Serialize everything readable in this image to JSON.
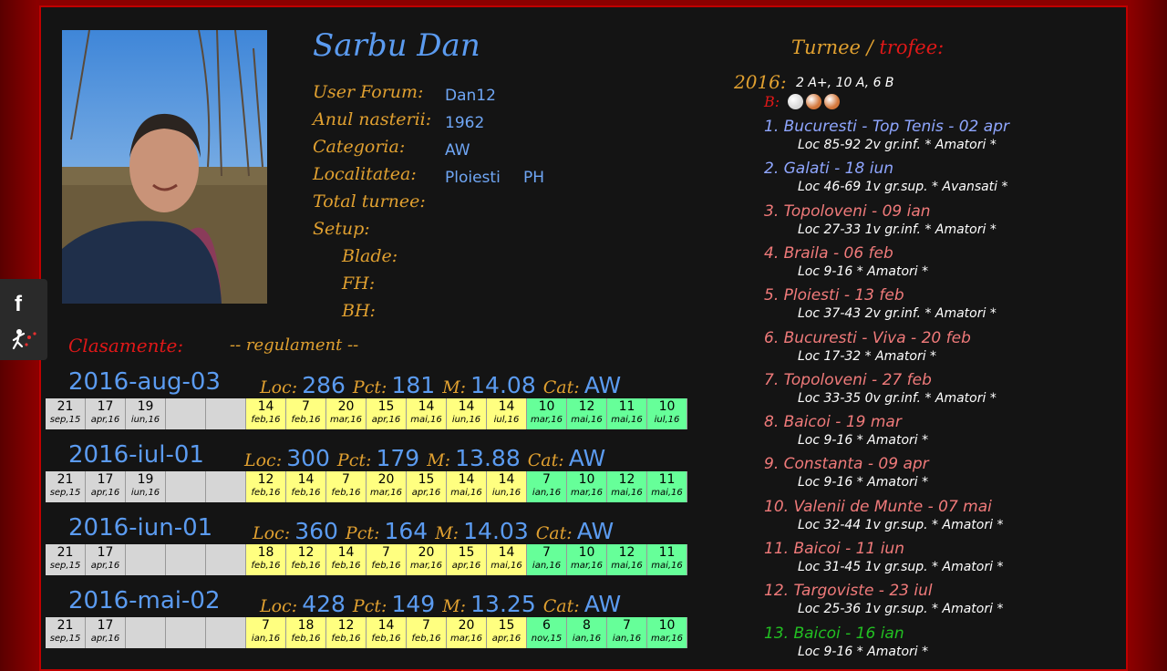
{
  "profile": {
    "name": "Sarbu Dan",
    "labels": [
      "User Forum:",
      "Anul nasterii:",
      "Categoria:",
      "Localitatea:",
      "Total turnee:",
      "Setup:"
    ],
    "setup_labels": [
      "Blade:",
      "FH:",
      "BH:"
    ],
    "user_forum": "Dan12",
    "anul_nasterii": "1962",
    "categoria": "AW",
    "localitatea": "Ploiesti",
    "judet": "PH"
  },
  "clasamente": {
    "title": "Clasamente:",
    "regulament": "-- regulament --",
    "stat_labels": {
      "loc": "Loc:",
      "pct": "Pct:",
      "m": "M:",
      "cat": "Cat:"
    },
    "blocks": [
      {
        "date": "2016-aug-03",
        "loc": "286",
        "pct": "181",
        "m": "14.08",
        "cat": "AW",
        "cells": [
          [
            "21",
            "sep,15",
            "g"
          ],
          [
            "17",
            "apr,16",
            "g"
          ],
          [
            "19",
            "iun,16",
            "g"
          ],
          [
            "",
            "",
            "g"
          ],
          [
            "",
            "",
            "g"
          ],
          [
            "14",
            "feb,16",
            "y"
          ],
          [
            "7",
            "feb,16",
            "y"
          ],
          [
            "20",
            "mar,16",
            "y"
          ],
          [
            "15",
            "apr,16",
            "y"
          ],
          [
            "14",
            "mai,16",
            "y"
          ],
          [
            "14",
            "iun,16",
            "y"
          ],
          [
            "14",
            "iul,16",
            "y"
          ],
          [
            "10",
            "mar,16",
            "gr"
          ],
          [
            "12",
            "mai,16",
            "gr"
          ],
          [
            "11",
            "mai,16",
            "gr"
          ],
          [
            "10",
            "iul,16",
            "gr"
          ]
        ]
      },
      {
        "date": "2016-iul-01",
        "loc": "300",
        "pct": "179",
        "m": "13.88",
        "cat": "AW",
        "cells": [
          [
            "21",
            "sep,15",
            "g"
          ],
          [
            "17",
            "apr,16",
            "g"
          ],
          [
            "19",
            "iun,16",
            "g"
          ],
          [
            "",
            "",
            "g"
          ],
          [
            "",
            "",
            "g"
          ],
          [
            "12",
            "feb,16",
            "y"
          ],
          [
            "14",
            "feb,16",
            "y"
          ],
          [
            "7",
            "feb,16",
            "y"
          ],
          [
            "20",
            "mar,16",
            "y"
          ],
          [
            "15",
            "apr,16",
            "y"
          ],
          [
            "14",
            "mai,16",
            "y"
          ],
          [
            "14",
            "iun,16",
            "y"
          ],
          [
            "7",
            "ian,16",
            "gr"
          ],
          [
            "10",
            "mar,16",
            "gr"
          ],
          [
            "12",
            "mai,16",
            "gr"
          ],
          [
            "11",
            "mai,16",
            "gr"
          ]
        ]
      },
      {
        "date": "2016-iun-01",
        "loc": "360",
        "pct": "164",
        "m": "14.03",
        "cat": "AW",
        "cells": [
          [
            "21",
            "sep,15",
            "g"
          ],
          [
            "17",
            "apr,16",
            "g"
          ],
          [
            "",
            "",
            "g"
          ],
          [
            "",
            "",
            "g"
          ],
          [
            "",
            "",
            "g"
          ],
          [
            "18",
            "feb,16",
            "y"
          ],
          [
            "12",
            "feb,16",
            "y"
          ],
          [
            "14",
            "feb,16",
            "y"
          ],
          [
            "7",
            "feb,16",
            "y"
          ],
          [
            "20",
            "mar,16",
            "y"
          ],
          [
            "15",
            "apr,16",
            "y"
          ],
          [
            "14",
            "mai,16",
            "y"
          ],
          [
            "7",
            "ian,16",
            "gr"
          ],
          [
            "10",
            "mar,16",
            "gr"
          ],
          [
            "12",
            "mai,16",
            "gr"
          ],
          [
            "11",
            "mai,16",
            "gr"
          ]
        ]
      },
      {
        "date": "2016-mai-02",
        "loc": "428",
        "pct": "149",
        "m": "13.25",
        "cat": "AW",
        "cells": [
          [
            "21",
            "sep,15",
            "g"
          ],
          [
            "17",
            "apr,16",
            "g"
          ],
          [
            "",
            "",
            "g"
          ],
          [
            "",
            "",
            "g"
          ],
          [
            "",
            "",
            "g"
          ],
          [
            "7",
            "ian,16",
            "y"
          ],
          [
            "18",
            "feb,16",
            "y"
          ],
          [
            "12",
            "feb,16",
            "y"
          ],
          [
            "14",
            "feb,16",
            "y"
          ],
          [
            "7",
            "feb,16",
            "y"
          ],
          [
            "20",
            "mar,16",
            "y"
          ],
          [
            "15",
            "apr,16",
            "y"
          ],
          [
            "6",
            "nov,15",
            "gr"
          ],
          [
            "8",
            "ian,16",
            "gr"
          ],
          [
            "7",
            "ian,16",
            "gr"
          ],
          [
            "10",
            "mar,16",
            "gr"
          ]
        ]
      }
    ]
  },
  "turnee": {
    "title_a": "Turnee",
    "title_sep": " / ",
    "title_b": "trofee:",
    "year": "2016:",
    "year_summary": "2 A+, 10 A, 6 B",
    "b_label": "B:",
    "medal_colors": [
      "#d8d8d8",
      "#d2763a",
      "#d2763a"
    ],
    "items": [
      {
        "title": "1. Bucuresti - Top Tenis - 02 apr",
        "detail": "Loc 85-92 2v gr.inf. * Amatori *",
        "color": "#8fa6ff"
      },
      {
        "title": "2. Galati - 18 iun",
        "detail": "Loc 46-69 1v gr.sup. * Avansati *",
        "color": "#8fa6ff"
      },
      {
        "title": "3. Topoloveni - 09 ian",
        "detail": "Loc 27-33 1v gr.inf. * Amatori *",
        "color": "#f07a7a"
      },
      {
        "title": "4. Braila - 06 feb",
        "detail": "Loc 9-16 * Amatori *",
        "color": "#f07a7a"
      },
      {
        "title": "5. Ploiesti - 13 feb",
        "detail": "Loc 37-43 2v gr.inf. * Amatori *",
        "color": "#f07a7a"
      },
      {
        "title": "6. Bucuresti - Viva - 20 feb",
        "detail": "Loc 17-32 * Amatori *",
        "color": "#f07a7a"
      },
      {
        "title": "7. Topoloveni - 27 feb",
        "detail": "Loc 33-35 0v gr.inf. * Amatori *",
        "color": "#f07a7a"
      },
      {
        "title": "8. Baicoi - 19 mar",
        "detail": "Loc 9-16 * Amatori *",
        "color": "#f07a7a"
      },
      {
        "title": "9. Constanta - 09 apr",
        "detail": "Loc 9-16 * Amatori *",
        "color": "#f07a7a"
      },
      {
        "title": "10. Valenii de Munte - 07 mai",
        "detail": "Loc 32-44 1v gr.sup. * Amatori *",
        "color": "#f07a7a"
      },
      {
        "title": "11. Baicoi - 11 iun",
        "detail": "Loc 31-45 1v gr.sup. * Amatori *",
        "color": "#f07a7a"
      },
      {
        "title": "12. Targoviste - 23 iul",
        "detail": "Loc 25-36 1v gr.sup. * Amatori *",
        "color": "#f07a7a"
      },
      {
        "title": "13. Baicoi - 16 ian",
        "detail": "Loc 9-16 * Amatori *",
        "color": "#22c022"
      }
    ]
  }
}
